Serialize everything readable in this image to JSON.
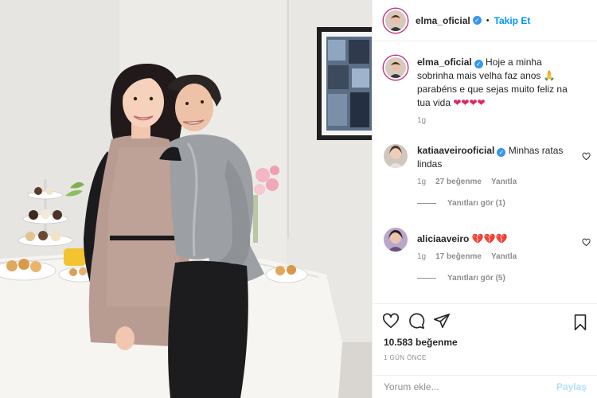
{
  "header": {
    "username": "elma_oficial",
    "separator": "•",
    "follow_label": "Takip Et",
    "verified_icon": "verified-badge-icon"
  },
  "caption": {
    "username": "elma_oficial",
    "text_before": "Hoje a minha sobrinha mais velha faz anos",
    "pray_emoji": "🙏",
    "text_after": "parabéns e que sejas muito feliz na tua vida",
    "hearts": "❤❤❤❤",
    "time": "1g"
  },
  "comments": [
    {
      "username": "katiaaveirooficial",
      "text": "Minhas ratas lindas",
      "time": "1g",
      "likes": "27 beğenme",
      "reply_label": "Yanıtla",
      "view_replies": "Yanıtları gör (1)"
    },
    {
      "username": "aliciaaveiro",
      "text": "💔💔💔",
      "time": "1g",
      "likes": "17 beğenme",
      "reply_label": "Yanıtla",
      "view_replies": "Yanıtları gör (5)"
    }
  ],
  "actions": {
    "likes": "10.583 beğenme",
    "date": "1 GÜN ÖNCE"
  },
  "add_comment": {
    "placeholder": "Yorum ekle...",
    "post_label": "Paylaş"
  },
  "colors": {
    "link_blue": "#0095f6",
    "verified_blue": "#3897f0",
    "muted": "#8e8e8e",
    "heart_red": "#e0245e",
    "post_disabled": "#b2dffc"
  }
}
